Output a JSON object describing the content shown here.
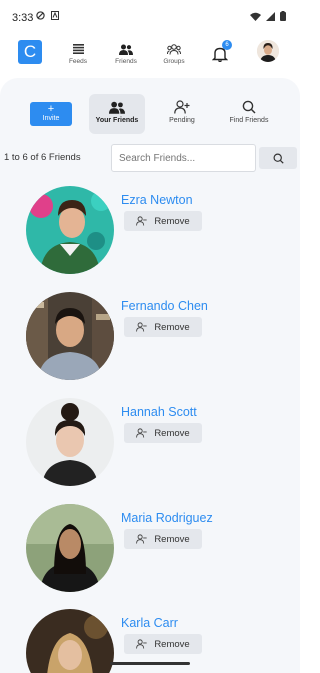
{
  "status_bar": {
    "time": "3:33"
  },
  "nav": {
    "logo_letter": "C",
    "items": [
      {
        "label": "Feeds",
        "icon": "feeds-icon"
      },
      {
        "label": "Friends",
        "icon": "friends-icon"
      },
      {
        "label": "Groups",
        "icon": "groups-icon"
      }
    ],
    "notification_count": "6"
  },
  "tabs": {
    "invite_label": "Invite",
    "items": [
      {
        "label": "Your Friends",
        "icon": "friends-icon",
        "active": true
      },
      {
        "label": "Pending",
        "icon": "add-user-icon",
        "active": false
      },
      {
        "label": "Find Friends",
        "icon": "search-icon",
        "active": false
      }
    ]
  },
  "search": {
    "count_text": "1 to 6 of 6 Friends",
    "placeholder": "Search Friends..."
  },
  "friends": [
    {
      "name": "Ezra Newton",
      "remove_label": "Remove"
    },
    {
      "name": "Fernando Chen",
      "remove_label": "Remove"
    },
    {
      "name": "Hannah Scott",
      "remove_label": "Remove"
    },
    {
      "name": "Maria Rodriguez",
      "remove_label": "Remove"
    },
    {
      "name": "Karla Carr",
      "remove_label": "Remove"
    }
  ],
  "colors": {
    "accent": "#2d8cf0",
    "background": "#f5f7fa",
    "button_grey": "#e4e7ec"
  }
}
